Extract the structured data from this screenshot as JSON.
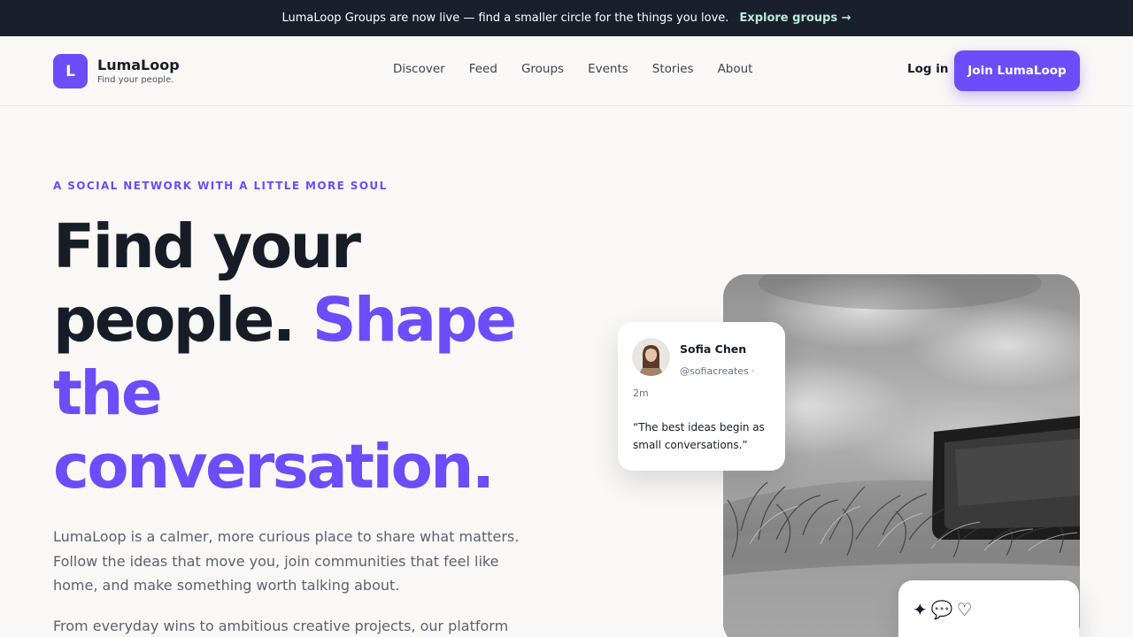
{
  "announcement": {
    "text": "LumaLoop Groups are now live — find a smaller circle for the things you love.",
    "link": "Explore groups →"
  },
  "brand": {
    "logo_letter": "L",
    "name": "LumaLoop",
    "tagline": "Find your people."
  },
  "nav": [
    {
      "label": "Discover"
    },
    {
      "label": "Feed"
    },
    {
      "label": "Groups"
    },
    {
      "label": "Events"
    },
    {
      "label": "Stories"
    },
    {
      "label": "About"
    }
  ],
  "header": {
    "login": "Log in",
    "cta": "Join LumaLoop"
  },
  "hero": {
    "eyebrow": "A SOCIAL NETWORK WITH A LITTLE MORE SOUL",
    "headline_plain": "Find your people.",
    "headline_accent": "Shape the conversation.",
    "lead": "LumaLoop is a calmer, more curious place to share what matters. Follow the ideas that move you, join communities that feel like home, and make something worth talking about.",
    "lead2": "From everyday wins to ambitious creative projects, our platform"
  },
  "post": {
    "name": "Sofia Chen",
    "handle": "@sofiacreates ·",
    "time": "2m",
    "body": "“The best ideas begin as small conversations.”"
  },
  "reactions": {
    "sparkle": "✦",
    "comment": "💬",
    "heart": "♡"
  },
  "colors": {
    "accent": "#6b4dfa",
    "announcement_bg": "#1a202b",
    "announcement_link": "#b9ead8",
    "page_bg": "#f9f8f6",
    "ink": "#171c26"
  },
  "icons": {
    "photo": "grayscale-photo-tv-in-grass",
    "avatar": "user-avatar-photo"
  }
}
